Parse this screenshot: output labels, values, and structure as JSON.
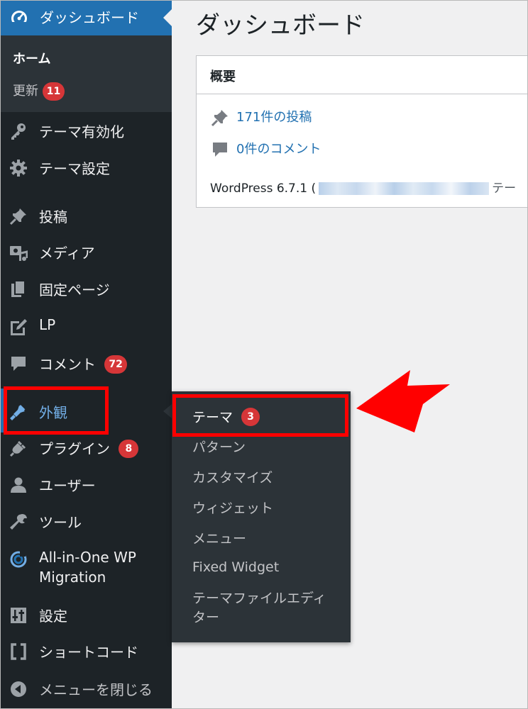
{
  "sidebar": {
    "dashboard": {
      "label": "ダッシュボード",
      "icon": "dashboard-icon"
    },
    "home_submenu": {
      "home_label": "ホーム",
      "updates_label": "更新",
      "updates_count": "11"
    },
    "items": [
      {
        "label": "テーマ有効化",
        "icon": "key-icon"
      },
      {
        "label": "テーマ設定",
        "icon": "gear-icon"
      },
      {
        "label": "投稿",
        "icon": "pushpin-icon"
      },
      {
        "label": "メディア",
        "icon": "media-icon"
      },
      {
        "label": "固定ページ",
        "icon": "pages-icon"
      },
      {
        "label": "LP",
        "icon": "edit-icon"
      },
      {
        "label": "コメント",
        "icon": "comment-icon",
        "badge": "72"
      },
      {
        "label": "外観",
        "icon": "paintbrush-icon"
      },
      {
        "label": "プラグイン",
        "icon": "plugin-icon",
        "badge": "8"
      },
      {
        "label": "ユーザー",
        "icon": "user-icon"
      },
      {
        "label": "ツール",
        "icon": "wrench-icon"
      },
      {
        "label_line1": "All-in-One WP",
        "label_line2": "Migration",
        "icon": "migration-icon"
      },
      {
        "label": "設定",
        "icon": "settings-sliders-icon"
      },
      {
        "label": "ショートコード",
        "icon": "shortcode-brackets-icon"
      },
      {
        "label": "メニューを閉じる",
        "icon": "collapse-arrow-icon"
      }
    ]
  },
  "flyout": {
    "items": [
      {
        "label": "テーマ",
        "badge": "3"
      },
      {
        "label": "パターン"
      },
      {
        "label": "カスタマイズ"
      },
      {
        "label": "ウィジェット"
      },
      {
        "label": "メニュー"
      },
      {
        "label": "Fixed Widget"
      },
      {
        "label_line1": "テーマファイルエディ",
        "label_line2": "ター"
      }
    ]
  },
  "main": {
    "page_title": "ダッシュボード",
    "overview": {
      "title": "概要",
      "posts_link": "171件の投稿",
      "comments_link": "0件のコメント",
      "wp_version_prefix": "WordPress 6.7.1 (",
      "wp_version_tail": "テー"
    }
  },
  "colors": {
    "sidebar_bg": "#1d2327",
    "submenu_bg": "#2c3338",
    "accent": "#2271b1",
    "badge": "#d63638",
    "highlight": "#ff0000"
  }
}
